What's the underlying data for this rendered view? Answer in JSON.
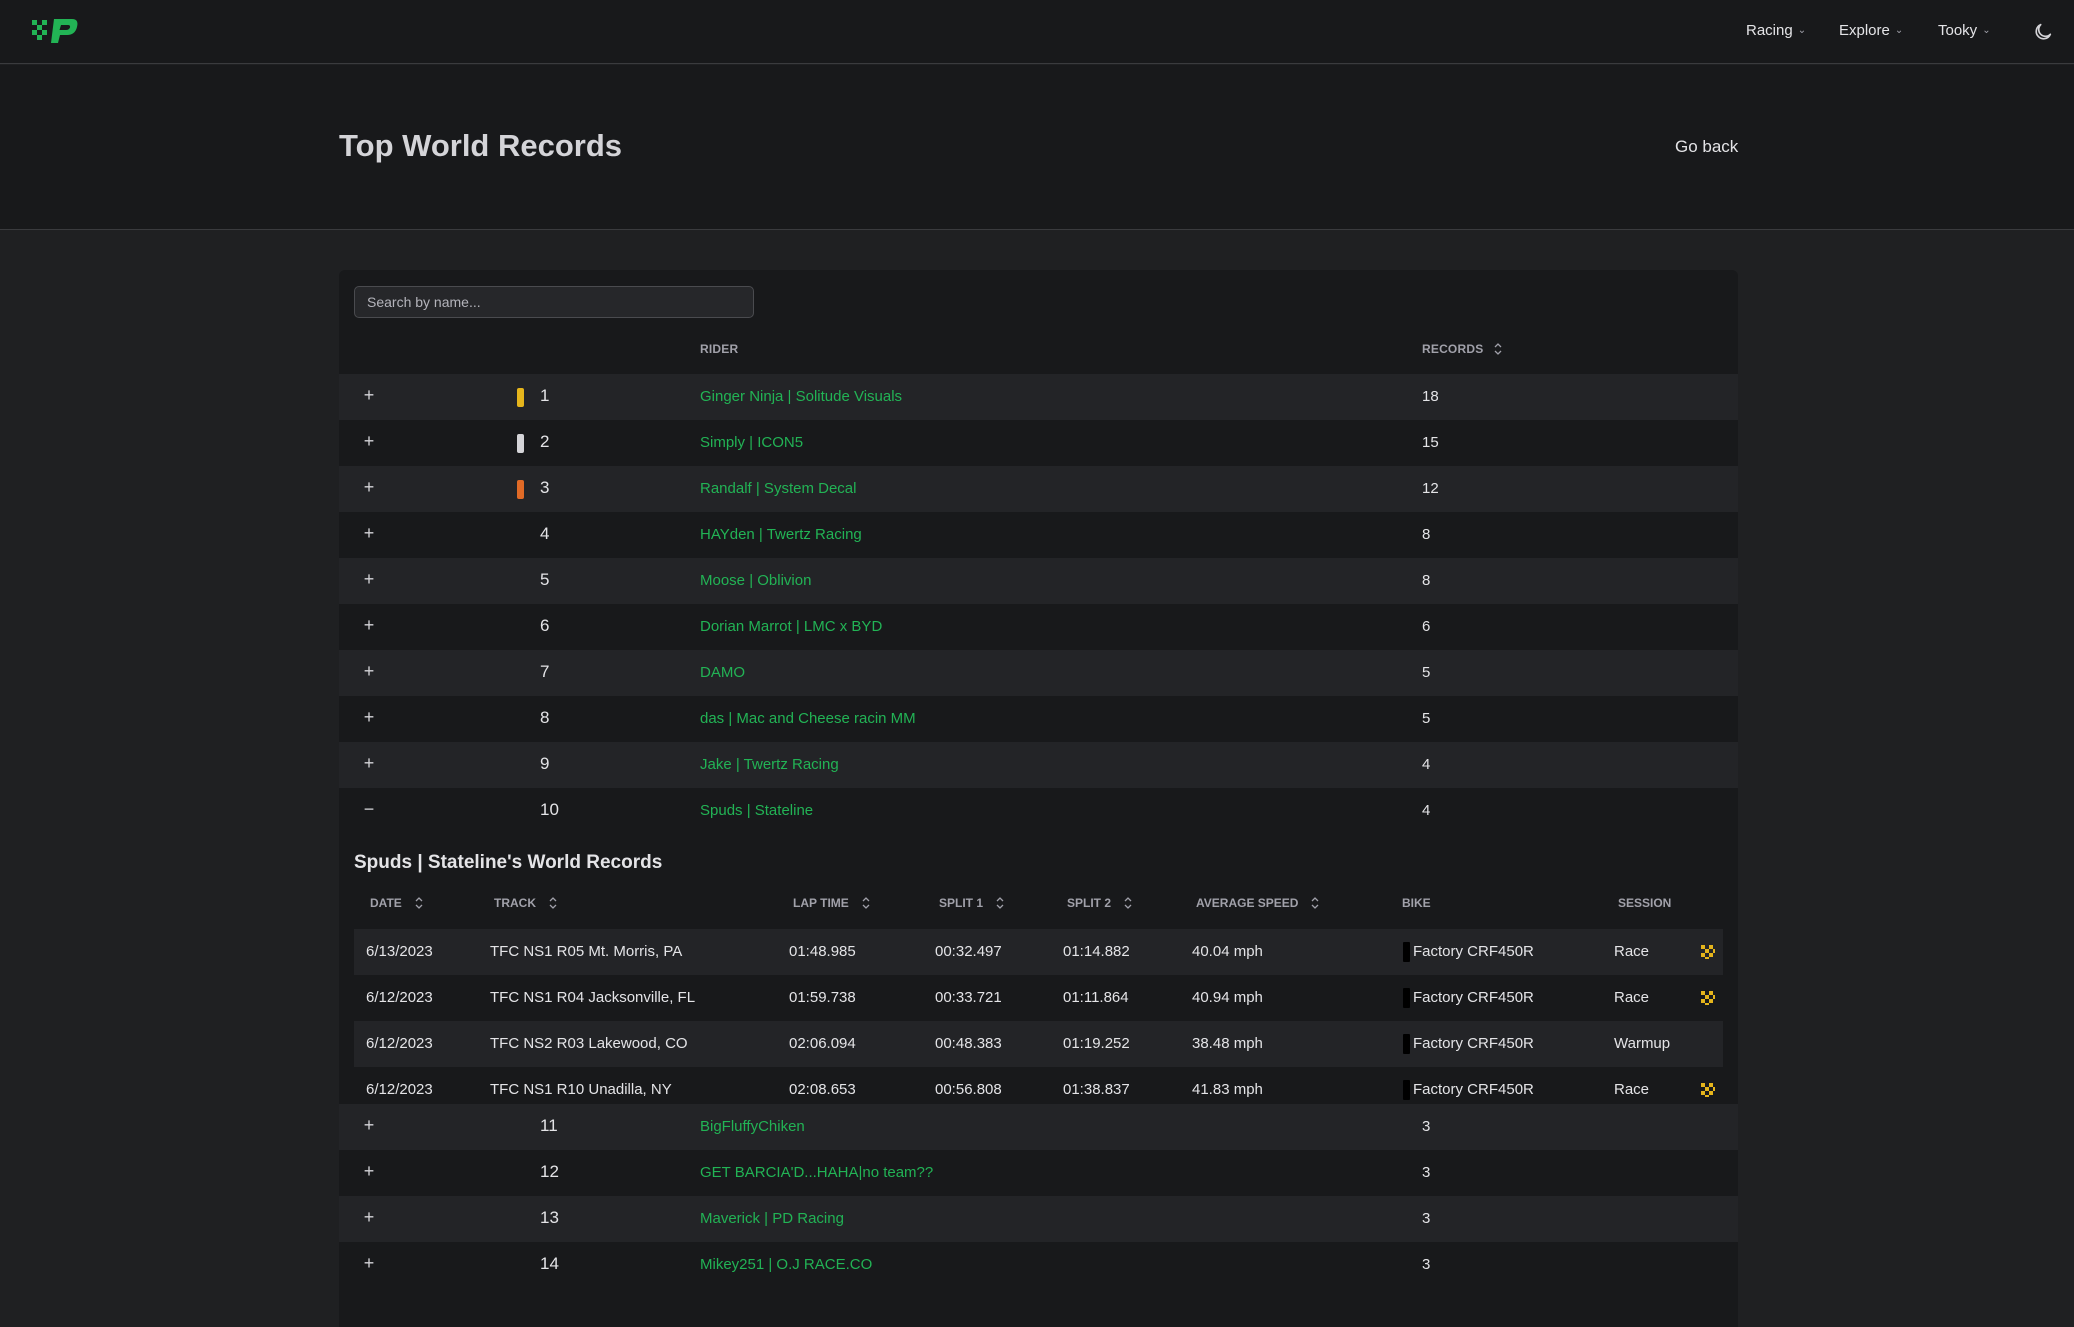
{
  "nav": {
    "items": [
      {
        "label": "Racing"
      },
      {
        "label": "Explore"
      },
      {
        "label": "Tooky"
      }
    ],
    "brand_color": "#22b355"
  },
  "header": {
    "title": "Top World Records",
    "go_back": "Go back"
  },
  "search": {
    "placeholder": "Search by name..."
  },
  "table": {
    "col_rider": "RIDER",
    "col_records": "RECORDS",
    "medal_colors": [
      "#e5b51c",
      "#d4d4d8",
      "#e06a26"
    ],
    "rows": [
      {
        "toggle": "+",
        "rank": "1",
        "rider": "Ginger Ninja | Solitude Visuals",
        "records": "18"
      },
      {
        "toggle": "+",
        "rank": "2",
        "rider": "Simply | ICON5",
        "records": "15"
      },
      {
        "toggle": "+",
        "rank": "3",
        "rider": "Randalf | System Decal",
        "records": "12"
      },
      {
        "toggle": "+",
        "rank": "4",
        "rider": "HAYden | Twertz Racing",
        "records": "8"
      },
      {
        "toggle": "+",
        "rank": "5",
        "rider": "Moose | Oblivion",
        "records": "8"
      },
      {
        "toggle": "+",
        "rank": "6",
        "rider": "Dorian Marrot | LMC x BYD",
        "records": "6"
      },
      {
        "toggle": "+",
        "rank": "7",
        "rider": "DAMO",
        "records": "5"
      },
      {
        "toggle": "+",
        "rank": "8",
        "rider": "das | Mac and Cheese racin MM",
        "records": "5"
      },
      {
        "toggle": "+",
        "rank": "9",
        "rider": "Jake | Twertz Racing",
        "records": "4"
      },
      {
        "toggle": "−",
        "rank": "10",
        "rider": "Spuds | Stateline",
        "records": "4"
      }
    ],
    "rows_after": [
      {
        "toggle": "+",
        "rank": "11",
        "rider": "BigFluffyChiken",
        "records": "3"
      },
      {
        "toggle": "+",
        "rank": "12",
        "rider": "GET BARCIA'D...HAHA|no team??",
        "records": "3"
      },
      {
        "toggle": "+",
        "rank": "13",
        "rider": "Maverick | PD Racing",
        "records": "3"
      },
      {
        "toggle": "+",
        "rank": "14",
        "rider": "Mikey251 | O.J RACE.CO",
        "records": "3"
      }
    ]
  },
  "expanded": {
    "title": "Spuds | Stateline's World Records",
    "columns": {
      "date": "DATE",
      "track": "TRACK",
      "lap_time": "LAP TIME",
      "split1": "SPLIT 1",
      "split2": "SPLIT 2",
      "avg_speed": "AVERAGE SPEED",
      "bike": "BIKE",
      "session": "SESSION"
    },
    "records": [
      {
        "date": "6/13/2023",
        "track": "TFC NS1 R05 Mt. Morris, PA",
        "lap_time": "01:48.985",
        "split1": "00:32.497",
        "split2": "01:14.882",
        "avg_speed": "40.04 mph",
        "bike": "Factory CRF450R",
        "session": "Race",
        "flag": "checkered-flag-icon"
      },
      {
        "date": "6/12/2023",
        "track": "TFC NS1 R04 Jacksonville, FL",
        "lap_time": "01:59.738",
        "split1": "00:33.721",
        "split2": "01:11.864",
        "avg_speed": "40.94 mph",
        "bike": "Factory CRF450R",
        "session": "Race",
        "flag": "checkered-flag-icon"
      },
      {
        "date": "6/12/2023",
        "track": "TFC NS2 R03 Lakewood, CO",
        "lap_time": "02:06.094",
        "split1": "00:48.383",
        "split2": "01:19.252",
        "avg_speed": "38.48 mph",
        "bike": "Factory CRF450R",
        "session": "Warmup",
        "flag": ""
      },
      {
        "date": "6/12/2023",
        "track": "TFC NS1 R10 Unadilla, NY",
        "lap_time": "02:08.653",
        "split1": "00:56.808",
        "split2": "01:38.837",
        "avg_speed": "41.83 mph",
        "bike": "Factory CRF450R",
        "session": "Race",
        "flag": "checkered-flag-icon"
      }
    ]
  }
}
